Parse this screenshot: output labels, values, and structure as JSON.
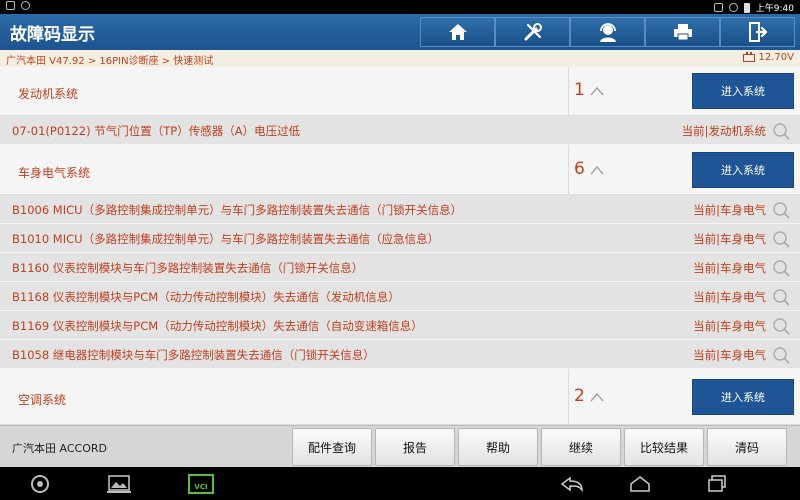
{
  "statusbar": {
    "time": "上午9:40"
  },
  "header": {
    "title": "故障码显示",
    "buttons": [
      {
        "name": "home-icon"
      },
      {
        "name": "diagnose-tools-icon"
      },
      {
        "name": "support-agent-icon"
      },
      {
        "name": "printer-icon"
      },
      {
        "name": "exit-icon"
      }
    ]
  },
  "breadcrumb": {
    "path": "广汽本田 V47.92 > 16PIN诊断座 > 快速测试",
    "voltage": "12.70V"
  },
  "systems": [
    {
      "name": "发动机系统",
      "count": "1",
      "enter_label": "进入系统",
      "faults": [
        {
          "text": "07-01(P0122) 节气门位置（TP）传感器（A）电压过低",
          "system": "当前|发动机系统"
        }
      ]
    },
    {
      "name": "车身电气系统",
      "count": "6",
      "enter_label": "进入系统",
      "faults": [
        {
          "text": "B1006 MICU（多路控制集成控制单元）与车门多路控制装置失去通信（门锁开关信息）",
          "system": "当前|车身电气"
        },
        {
          "text": "B1010 MICU（多路控制集成控制单元）与车门多路控制装置失去通信（应急信息）",
          "system": "当前|车身电气"
        },
        {
          "text": "B1160 仪表控制模块与车门多路控制装置失去通信（门锁开关信息）",
          "system": "当前|车身电气"
        },
        {
          "text": "B1168 仪表控制模块与PCM（动力传动控制模块）失去通信（发动机信息）",
          "system": "当前|车身电气"
        },
        {
          "text": "B1169 仪表控制模块与PCM（动力传动控制模块）失去通信（自动变速箱信息）",
          "system": "当前|车身电气"
        },
        {
          "text": "B1058 继电器控制模块与车门多路控制装置失去通信（门锁开关信息）",
          "system": "当前|车身电气"
        }
      ]
    },
    {
      "name": "空调系统",
      "count": "2",
      "enter_label": "进入系统",
      "faults": []
    }
  ],
  "footer": {
    "vehicle": "广汽本田 ACCORD",
    "buttons": [
      "配件查询",
      "报告",
      "帮助",
      "继续",
      "比较结果",
      "清码"
    ]
  },
  "navbar": {
    "vci_label": "VCI"
  },
  "colors": {
    "accent": "#c0401f",
    "header_blue": "#1d5490",
    "enter_button": "#1f5596"
  }
}
